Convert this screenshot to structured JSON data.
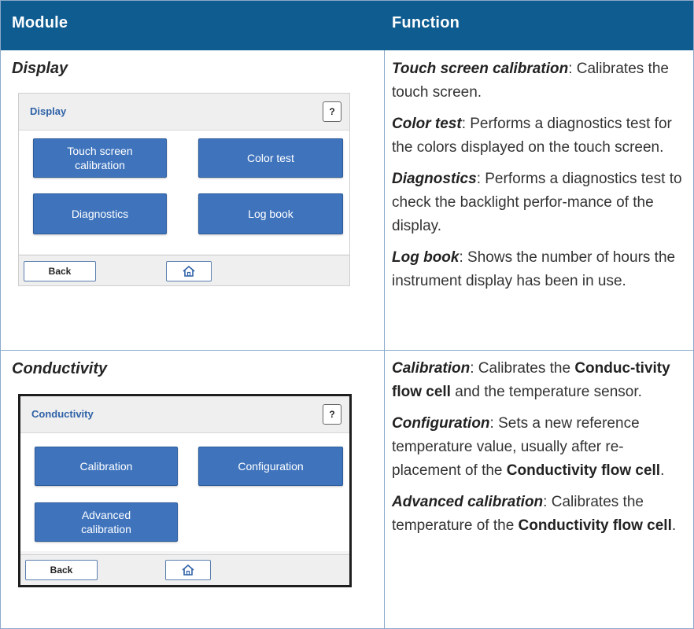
{
  "header": {
    "module": "Module",
    "function": "Function"
  },
  "rows": [
    {
      "module": "Display",
      "panel": {
        "title": "Display",
        "help": "?",
        "tiles": [
          "Touch screen\ncalibration",
          "Color test",
          "Diagnostics",
          "Log book"
        ],
        "back": "Back"
      },
      "functions": [
        {
          "term": "Touch screen calibration",
          "text": ": Calibrates the touch screen."
        },
        {
          "term": "Color test",
          "text": ": Performs a diagnostics test for the colors displayed on the touch screen."
        },
        {
          "term": "Diagnostics",
          "text": ": Performs a diagnostics test to check the backlight perfor-mance of the display."
        },
        {
          "term": "Log book",
          "text": ": Shows the number of hours the instrument display has been in use."
        }
      ]
    },
    {
      "module": "Conductivity",
      "panel": {
        "title": "Conductivity",
        "help": "?",
        "tiles": [
          "Calibration",
          "Configuration",
          "Advanced\ncalibration"
        ],
        "back": "Back"
      },
      "functions": [
        {
          "term": "Calibration",
          "t1": ": Calibrates the ",
          "b1": "Conduc-tivity flow cell",
          "t2": " and the temperature sensor."
        },
        {
          "term": "Configuration",
          "t1": ": Sets a new reference temperature value, usually after re-placement of the ",
          "b1": "Conductivity flow cell",
          "t2": "."
        },
        {
          "term": "Advanced calibration",
          "t1": ": Calibrates the temperature of the ",
          "b1": "Conductivity flow cell",
          "t2": "."
        }
      ]
    }
  ],
  "icons": {
    "home": "home-icon"
  },
  "colors": {
    "header_bg": "#0f5c91",
    "tile_bg": "#3f74bd",
    "border": "#8ba9cb"
  }
}
